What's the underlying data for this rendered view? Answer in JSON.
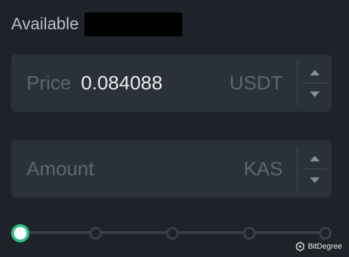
{
  "available": {
    "label": "Available",
    "value_redacted": true
  },
  "price_field": {
    "label": "Price",
    "value": "0.084088",
    "unit": "USDT"
  },
  "amount_field": {
    "label": "Amount",
    "value": "",
    "unit": "KAS"
  },
  "slider": {
    "value_percent": 0,
    "stops_percent": [
      0,
      25,
      50,
      75,
      100
    ],
    "accent_color": "#2ebd85"
  },
  "watermark": {
    "text": "BitDegree"
  },
  "colors": {
    "background": "#1e2329",
    "field": "#2b3139",
    "muted_text": "#5e6673",
    "text": "#eaecef"
  }
}
